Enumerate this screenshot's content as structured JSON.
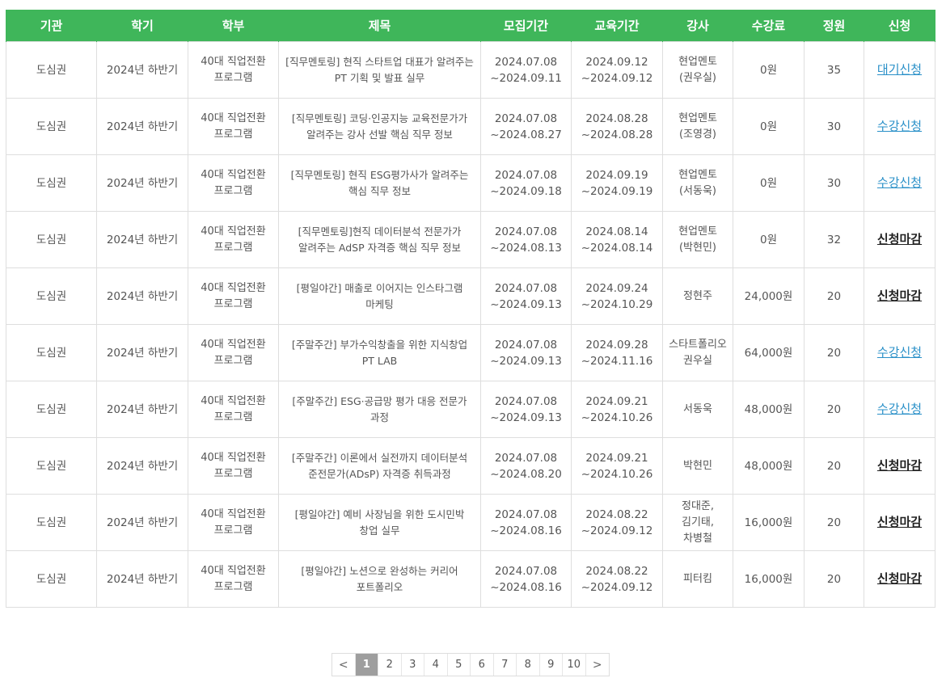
{
  "headers": [
    "기관",
    "학기",
    "학부",
    "제목",
    "모집기간",
    "교육기간",
    "강사",
    "수강료",
    "정원",
    "신청"
  ],
  "rows": [
    {
      "org": "도심권",
      "term": "2024년 하반기",
      "dept": "40대 직업전환 프로그램",
      "title": "[직무멘토링] 현직 스타트업 대표가 알려주는 PT 기획 및 발표 실무",
      "recruit": "2024.07.08 ~2024.09.11",
      "edu": "2024.09.12 ~2024.09.12",
      "instructor": "현업멘토(권우실)",
      "fee": "0원",
      "capacity": "35",
      "apply": "대기신청",
      "status": "open"
    },
    {
      "org": "도심권",
      "term": "2024년 하반기",
      "dept": "40대 직업전환 프로그램",
      "title": "[직무멘토링] 코딩·인공지능 교육전문가가 알려주는 강사 선발 핵심 직무 정보",
      "recruit": "2024.07.08 ~2024.08.27",
      "edu": "2024.08.28 ~2024.08.28",
      "instructor": "현업멘토(조영경)",
      "fee": "0원",
      "capacity": "30",
      "apply": "수강신청",
      "status": "open"
    },
    {
      "org": "도심권",
      "term": "2024년 하반기",
      "dept": "40대 직업전환 프로그램",
      "title": "[직무멘토링] 현직 ESG평가사가 알려주는 핵심 직무 정보",
      "recruit": "2024.07.08 ~2024.09.18",
      "edu": "2024.09.19 ~2024.09.19",
      "instructor": "현업멘토(서동욱)",
      "fee": "0원",
      "capacity": "30",
      "apply": "수강신청",
      "status": "open"
    },
    {
      "org": "도심권",
      "term": "2024년 하반기",
      "dept": "40대 직업전환 프로그램",
      "title": "[직무멘토링]현직 데이터분석 전문가가 알려주는 AdSP 자격증 핵심 직무 정보",
      "recruit": "2024.07.08 ~2024.08.13",
      "edu": "2024.08.14 ~2024.08.14",
      "instructor": "현업멘토(박현민)",
      "fee": "0원",
      "capacity": "32",
      "apply": "신청마감",
      "status": "closed"
    },
    {
      "org": "도심권",
      "term": "2024년 하반기",
      "dept": "40대 직업전환 프로그램",
      "title": "[평일야간] 매출로 이어지는 인스타그램 마케팅",
      "recruit": "2024.07.08 ~2024.09.13",
      "edu": "2024.09.24 ~2024.10.29",
      "instructor": "정현주",
      "fee": "24,000원",
      "capacity": "20",
      "apply": "신청마감",
      "status": "closed"
    },
    {
      "org": "도심권",
      "term": "2024년 하반기",
      "dept": "40대 직업전환 프로그램",
      "title": "[주말주간] 부가수익창출을 위한 지식창업 PT LAB",
      "recruit": "2024.07.08 ~2024.09.13",
      "edu": "2024.09.28 ~2024.11.16",
      "instructor": "스타트폴리오 권우실",
      "fee": "64,000원",
      "capacity": "20",
      "apply": "수강신청",
      "status": "open"
    },
    {
      "org": "도심권",
      "term": "2024년 하반기",
      "dept": "40대 직업전환 프로그램",
      "title": "[주말주간] ESG·공급망 평가 대응 전문가 과정",
      "recruit": "2024.07.08 ~2024.09.13",
      "edu": "2024.09.21 ~2024.10.26",
      "instructor": "서동욱",
      "fee": "48,000원",
      "capacity": "20",
      "apply": "수강신청",
      "status": "open"
    },
    {
      "org": "도심권",
      "term": "2024년 하반기",
      "dept": "40대 직업전환 프로그램",
      "title": "[주말주간] 이론에서 실전까지 데이터분석 준전문가(ADsP) 자격증 취득과정",
      "recruit": "2024.07.08 ~2024.08.20",
      "edu": "2024.09.21 ~2024.10.26",
      "instructor": "박현민",
      "fee": "48,000원",
      "capacity": "20",
      "apply": "신청마감",
      "status": "closed"
    },
    {
      "org": "도심권",
      "term": "2024년 하반기",
      "dept": "40대 직업전환 프로그램",
      "title": "[평일야간] 예비 사장님을 위한 도시민박 창업 실무",
      "recruit": "2024.07.08 ~2024.08.16",
      "edu": "2024.08.22 ~2024.09.12",
      "instructor": "정대준,김기태,차병철",
      "fee": "16,000원",
      "capacity": "20",
      "apply": "신청마감",
      "status": "closed"
    },
    {
      "org": "도심권",
      "term": "2024년 하반기",
      "dept": "40대 직업전환 프로그램",
      "title": "[평일야간] 노션으로 완성하는 커리어 포트폴리오",
      "recruit": "2024.07.08 ~2024.08.16",
      "edu": "2024.08.22 ~2024.09.12",
      "instructor": "피터킴",
      "fee": "16,000원",
      "capacity": "20",
      "apply": "신청마감",
      "status": "closed"
    }
  ],
  "pagination": {
    "prev": "<",
    "next": ">",
    "pages": [
      "1",
      "2",
      "3",
      "4",
      "5",
      "6",
      "7",
      "8",
      "9",
      "10"
    ],
    "current": "1"
  },
  "colors": {
    "header_bg": "#3fb65a",
    "link_open": "#2a90c8",
    "link_closed": "#222222",
    "page_active_bg": "#9e9e9e"
  },
  "icons": {
    "prev": "chevron-left-icon",
    "next": "chevron-right-icon"
  }
}
